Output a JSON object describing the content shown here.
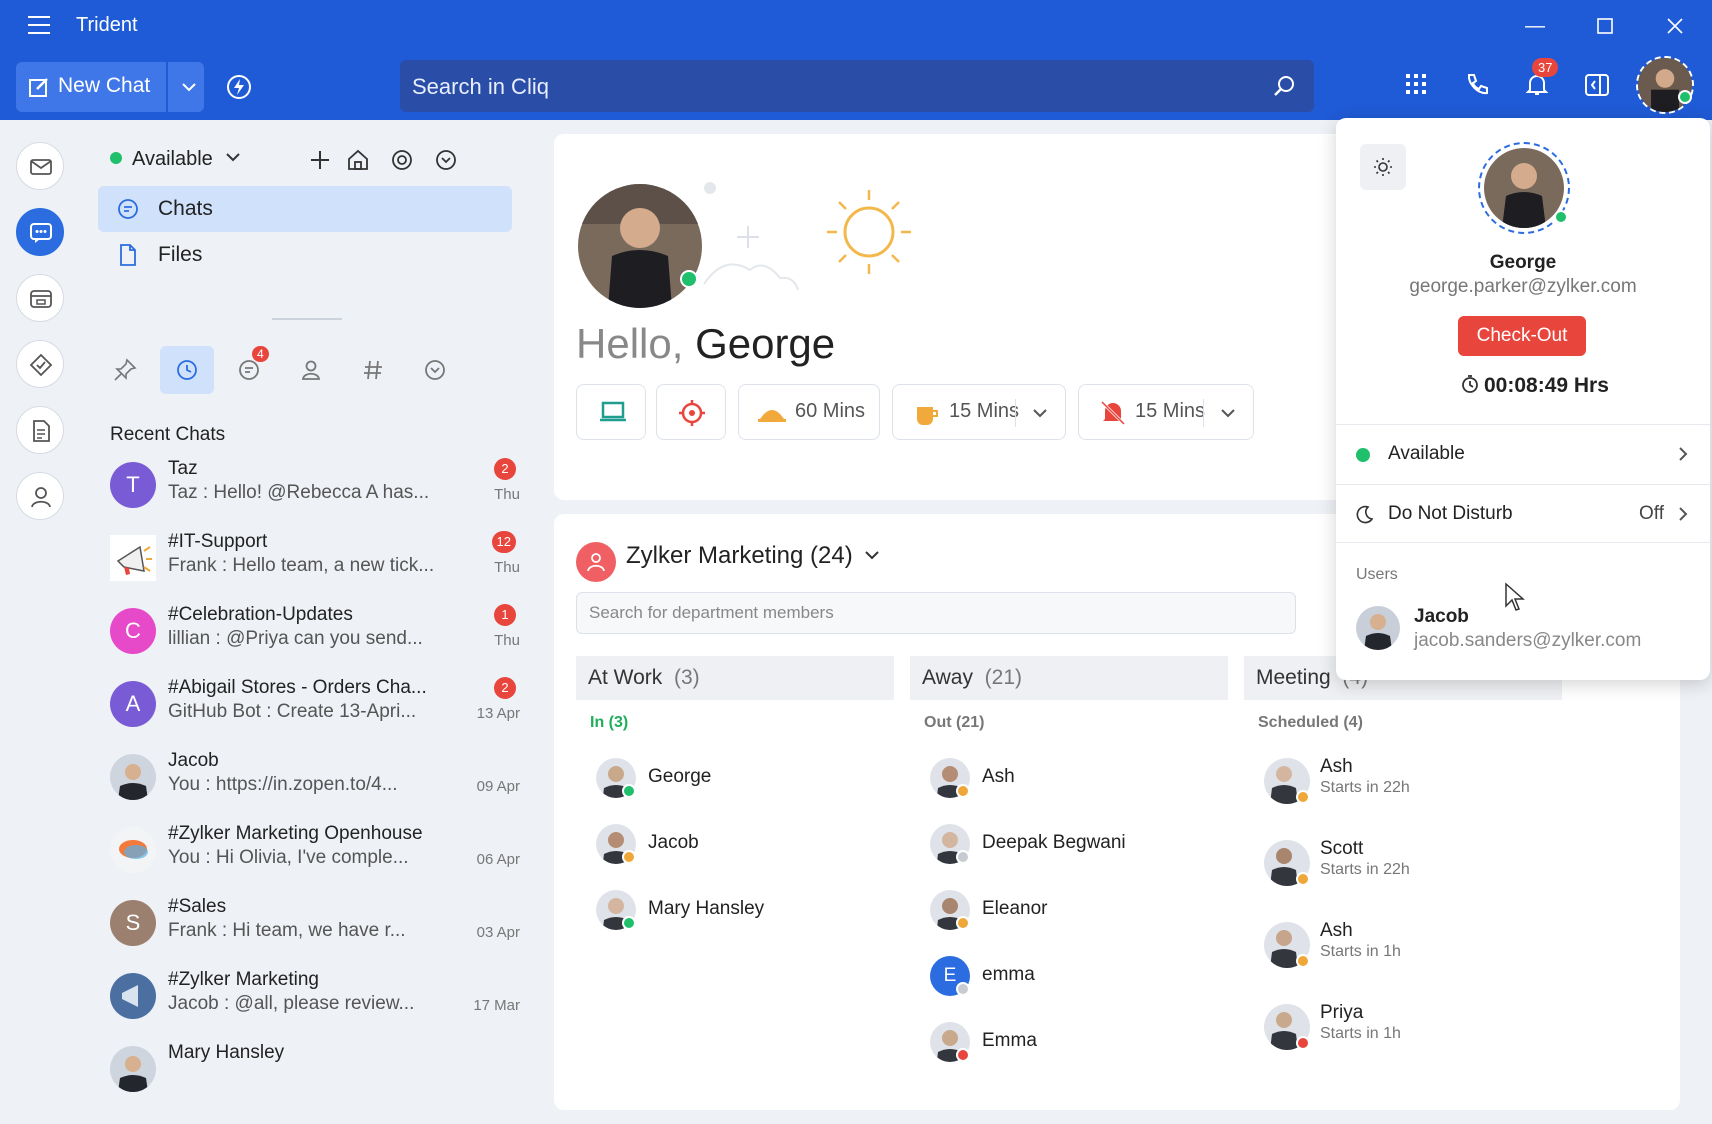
{
  "app": {
    "title": "Trident"
  },
  "toolbar": {
    "new_chat_label": "New Chat",
    "search_placeholder": "Search in Cliq",
    "notification_count": "37"
  },
  "sidebar": {
    "status": "Available",
    "nav": [
      {
        "label": "Chats"
      },
      {
        "label": "Files"
      }
    ],
    "unread_tab_badge": "4",
    "recent_title": "Recent Chats",
    "chats": [
      {
        "name": "Taz",
        "message": "Taz : Hello! @Rebecca A has...",
        "date": "Thu",
        "badge": "2",
        "initial": "T",
        "color": "#7a5bd6"
      },
      {
        "name": "#IT-Support",
        "message": "Frank : Hello team, a new tick...",
        "date": "Thu",
        "badge": "12",
        "initial": "",
        "color": "#ffffff"
      },
      {
        "name": "#Celebration-Updates",
        "message": "lillian : @Priya can you send...",
        "date": "Thu",
        "badge": "1",
        "initial": "C",
        "color": "#e64ac9"
      },
      {
        "name": "#Abigail Stores - Orders Cha...",
        "message": "GitHub Bot : Create 13-Apri...",
        "date": "13 Apr",
        "badge": "2",
        "initial": "A",
        "color": "#7a5bd6"
      },
      {
        "name": "Jacob",
        "message": "You : https://in.zopen.to/4...",
        "date": "09 Apr",
        "badge": "",
        "initial": "",
        "color": "#cfd5de"
      },
      {
        "name": "#Zylker Marketing Openhouse",
        "message": "You : Hi Olivia, I've comple...",
        "date": "06 Apr",
        "badge": "",
        "initial": "",
        "color": "#f3f4f6"
      },
      {
        "name": "#Sales",
        "message": "Frank : Hi team, we have r...",
        "date": "03 Apr",
        "badge": "",
        "initial": "S",
        "color": "#9b7f6f"
      },
      {
        "name": "#Zylker Marketing",
        "message": "Jacob : @all, please review...",
        "date": "17 Mar",
        "badge": "",
        "initial": "",
        "color": "#4a6fa0"
      },
      {
        "name": "Mary Hansley",
        "message": "",
        "date": "",
        "badge": "",
        "initial": "",
        "color": "#cfd5de"
      }
    ]
  },
  "main": {
    "hello": "Hello,",
    "user_first_name": "George",
    "pills": [
      {
        "label": ""
      },
      {
        "label": ""
      },
      {
        "label": "60 Mins"
      },
      {
        "label": "15 Mins"
      },
      {
        "label": "15 Mins"
      }
    ],
    "department": {
      "title": "Zylker Marketing (24)",
      "search_placeholder": "Search for department members",
      "columns": [
        {
          "title": "At Work",
          "count": "(3)",
          "subtitle": "In (3)",
          "subcolor": "#1fae5b",
          "members": [
            {
              "name": "George",
              "status": "#1fbf6b"
            },
            {
              "name": "Jacob",
              "status": "#f0a73a"
            },
            {
              "name": "Mary Hansley",
              "status": "#1fbf6b"
            }
          ]
        },
        {
          "title": "Away",
          "count": "(21)",
          "subtitle": "Out (21)",
          "subcolor": "#777777",
          "members": [
            {
              "name": "Ash",
              "status": "#f0a73a"
            },
            {
              "name": "Deepak Begwani",
              "status": "#c8ccd2"
            },
            {
              "name": "Eleanor",
              "status": "#f0a73a"
            },
            {
              "name": "emma",
              "status": "#c8ccd2"
            },
            {
              "name": "Emma",
              "status": "#e8453c"
            }
          ]
        },
        {
          "title": "Meeting",
          "count": "(4)",
          "subtitle": "Scheduled (4)",
          "subcolor": "#777777",
          "members": [
            {
              "name": "Ash",
              "sub": "Starts in 22h",
              "status": "#f0a73a"
            },
            {
              "name": "Scott",
              "sub": "Starts in 22h",
              "status": "#f0a73a"
            },
            {
              "name": "Ash",
              "sub": "Starts in 1h",
              "status": "#f0a73a"
            },
            {
              "name": "Priya",
              "sub": "Starts in 1h",
              "status": "#e8453c"
            }
          ]
        }
      ]
    }
  },
  "popup": {
    "name": "George",
    "email": "george.parker@zylker.com",
    "checkout_label": "Check-Out",
    "timer": "00:08:49 Hrs",
    "status_row": "Available",
    "dnd_row": "Do Not Disturb",
    "dnd_value": "Off",
    "users_label": "Users",
    "user": {
      "name": "Jacob",
      "email": "jacob.sanders@zylker.com"
    }
  },
  "colors": {
    "brand": "#1f5bd6",
    "accent": "#2b6de0",
    "danger": "#e8453c",
    "online": "#1fbf6b"
  }
}
